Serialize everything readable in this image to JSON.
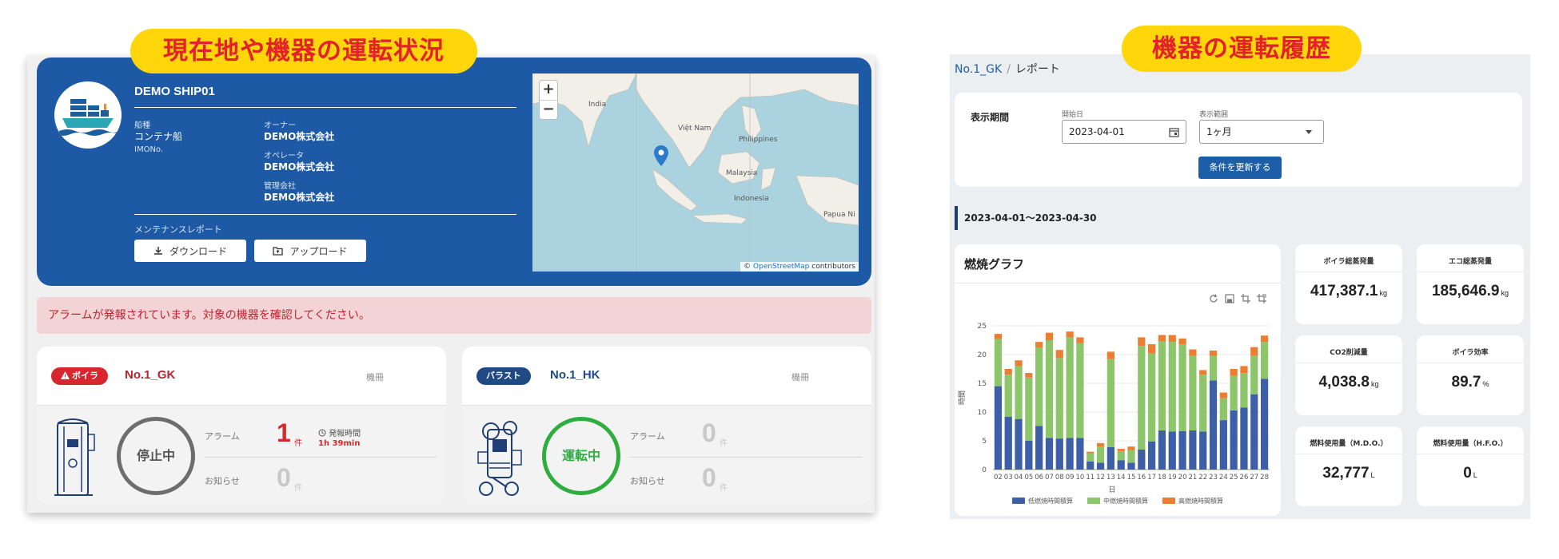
{
  "callouts": {
    "left": "現在地や機器の運転状況",
    "right": "機器の運転履歴"
  },
  "ship": {
    "name": "DEMO SHIP01",
    "type_label": "船種",
    "type_value": "コンテナ船",
    "imo_label": "IMONo.",
    "owner_label": "オーナー",
    "owner_value": "DEMO株式会社",
    "operator_label": "オペレータ",
    "operator_value": "DEMO株式会社",
    "manager_label": "管理会社",
    "manager_value": "DEMO株式会社",
    "maintenance_label": "メンテナンスレポート",
    "download_label": "ダウンロード",
    "upload_label": "アップロード"
  },
  "map": {
    "zoom_in": "+",
    "zoom_out": "−",
    "labels": [
      "India",
      "Việt Nam",
      "Philippines",
      "Malaysia",
      "Indonesia",
      "Papua Ni"
    ],
    "attribution_prefix": "© ",
    "attribution_link": "OpenStreetMap",
    "attribution_suffix": " contributors"
  },
  "alert": "アラームが発報されています。対象の機器を確認してください。",
  "equipment": [
    {
      "badge": "ボイラ",
      "name": "No.1_GK",
      "machine_label": "機冊",
      "status": "停止中",
      "alarm_label": "アラーム",
      "alarm_count": "1",
      "unit": "件",
      "occurred_label": "発報時間",
      "occurred_value": "1h 39min",
      "notice_label": "お知らせ",
      "notice_count": "0"
    },
    {
      "badge": "バラスト",
      "name": "No.1_HK",
      "machine_label": "機冊",
      "status": "運転中",
      "alarm_label": "アラーム",
      "alarm_count": "0",
      "unit": "件",
      "notice_label": "お知らせ",
      "notice_count": "0"
    }
  ],
  "report": {
    "breadcrumb_link": "No.1_GK",
    "breadcrumb_sep": "/",
    "breadcrumb_current": "レポート",
    "filter_title": "表示期間",
    "start_label": "開始日",
    "start_value": "2023-04-01",
    "range_label": "表示範囲",
    "range_value": "1ヶ月",
    "update_button": "条件を更新する",
    "period": "2023-04-01～2023-04-30",
    "chart_title": "燃焼グラフ"
  },
  "stats": [
    {
      "label": "ボイラ総蒸発量",
      "value": "417,387.1",
      "unit": "kg"
    },
    {
      "label": "エコ総蒸発量",
      "value": "185,646.9",
      "unit": "kg"
    },
    {
      "label": "CO2削減量",
      "value": "4,038.8",
      "unit": "kg"
    },
    {
      "label": "ボイラ効率",
      "value": "89.7",
      "unit": "%"
    },
    {
      "label": "燃料使用量（M.D.O.）",
      "value": "32,777",
      "unit": "L"
    },
    {
      "label": "燃料使用量（H.F.O.）",
      "value": "0",
      "unit": "L"
    }
  ],
  "colors": {
    "low": "#3d5fa8",
    "mid": "#8cc56a",
    "high": "#ed7d31",
    "alert_red": "#d7262e",
    "ship_blue": "#1d59a5"
  },
  "chart_data": {
    "type": "bar",
    "stacked": true,
    "categories": [
      "02",
      "03",
      "04",
      "05",
      "06",
      "07",
      "08",
      "09",
      "10",
      "11",
      "12",
      "13",
      "14",
      "15",
      "16",
      "17",
      "18",
      "19",
      "20",
      "21",
      "22",
      "23",
      "24",
      "25",
      "26",
      "27",
      "28"
    ],
    "series": [
      {
        "name": "低燃焼時間積算",
        "values": [
          14.5,
          9.2,
          8.8,
          5.0,
          7.6,
          5.5,
          5.4,
          5.5,
          5.5,
          1.4,
          1.2,
          3.9,
          1.6,
          1.2,
          3.5,
          4.9,
          6.8,
          6.6,
          6.7,
          6.8,
          6.6,
          15.5,
          8.6,
          10.3,
          10.8,
          13.1,
          15.8
        ]
      },
      {
        "name": "中燃焼時間積算",
        "values": [
          8.2,
          7.3,
          9.2,
          11.0,
          13.6,
          17.0,
          14.0,
          17.5,
          16.5,
          1.4,
          2.8,
          15.3,
          1.6,
          2.2,
          18.0,
          15.3,
          15.5,
          15.6,
          15.1,
          13.0,
          9.9,
          4.3,
          3.8,
          6.0,
          6.0,
          6.7,
          6.4
        ]
      },
      {
        "name": "高燃焼時間積算",
        "values": [
          0.9,
          1.0,
          1.0,
          0.8,
          1.0,
          1.3,
          1.4,
          1.0,
          1.0,
          0.3,
          0.6,
          1.3,
          0.4,
          0.6,
          1.5,
          1.6,
          1.1,
          1.2,
          1.0,
          1.1,
          0.8,
          0.9,
          1.0,
          1.2,
          1.2,
          1.5,
          1.1
        ]
      }
    ],
    "ylim": [
      0,
      25
    ],
    "yticks": [
      0,
      5,
      10,
      15,
      20,
      25
    ],
    "xlabel": "日",
    "ylabel": "時間",
    "legend_position": "bottom"
  }
}
